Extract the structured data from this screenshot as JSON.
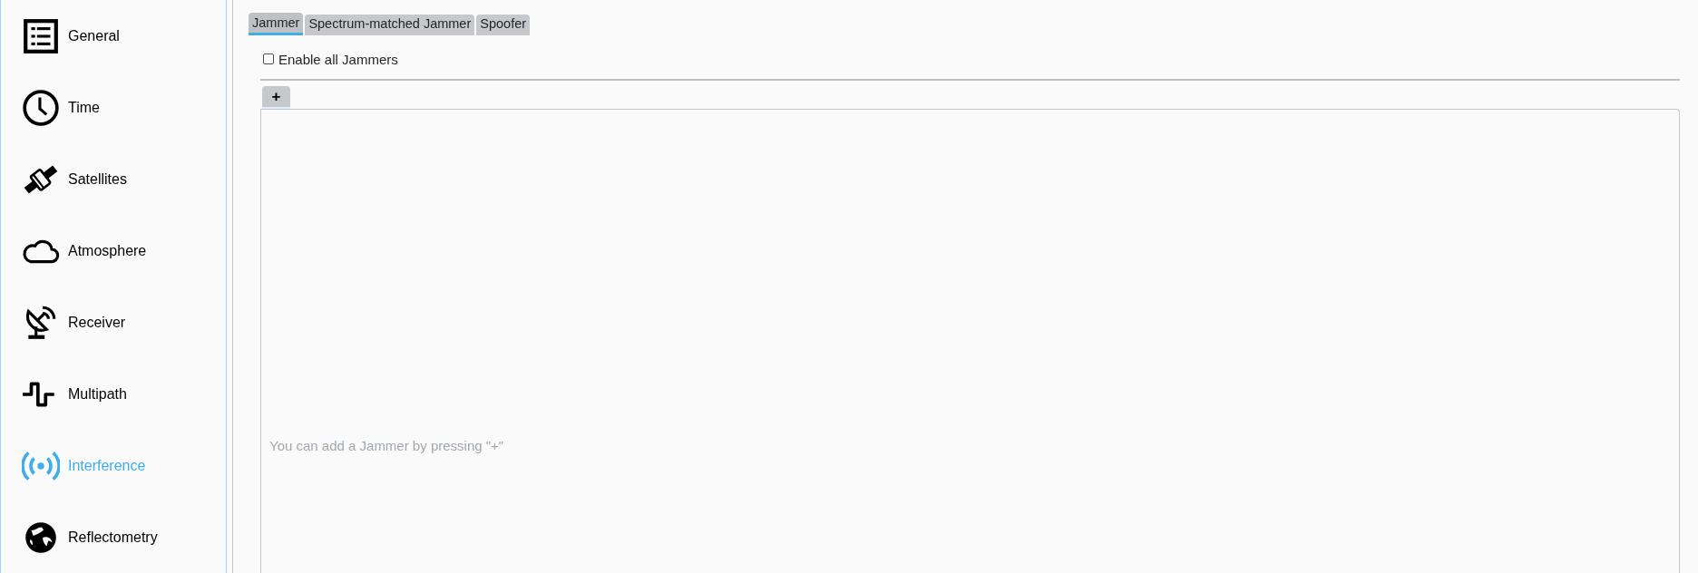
{
  "sidebar": {
    "items": [
      {
        "label": "General",
        "selected": false
      },
      {
        "label": "Time",
        "selected": false
      },
      {
        "label": "Satellites",
        "selected": false
      },
      {
        "label": "Atmosphere",
        "selected": false
      },
      {
        "label": "Receiver",
        "selected": false
      },
      {
        "label": "Multipath",
        "selected": false
      },
      {
        "label": "Interference",
        "selected": true
      },
      {
        "label": "Reflectometry",
        "selected": false
      }
    ]
  },
  "tabs": [
    {
      "label": "Jammer",
      "selected": true
    },
    {
      "label": "Spectrum-matched Jammer",
      "selected": false
    },
    {
      "label": "Spoofer",
      "selected": false
    }
  ],
  "enable_all": {
    "label": "Enable all Jammers",
    "checked": false
  },
  "list_tabs": [
    {
      "label": "+",
      "selected": true
    }
  ],
  "list_panel": {
    "empty_message": "You can add a Jammer by pressing \"+\""
  }
}
